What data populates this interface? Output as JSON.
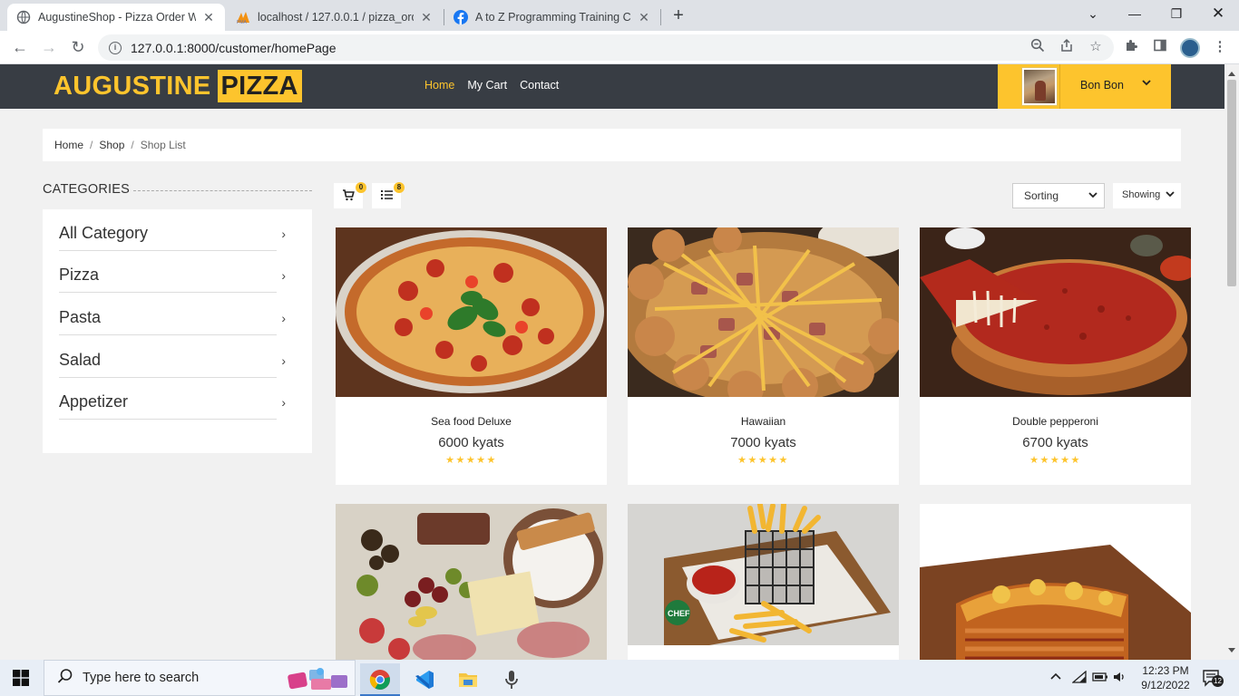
{
  "browser": {
    "tabs": [
      {
        "title": "AugustineShop - Pizza Order We",
        "active": true,
        "icon": "globe-icon"
      },
      {
        "title": "localhost / 127.0.0.1 / pizza_orde",
        "active": false,
        "icon": "phpmyadmin-icon"
      },
      {
        "title": "A to Z Programming Training Co",
        "active": false,
        "icon": "facebook-icon"
      }
    ],
    "url": "127.0.0.1:8000/customer/homePage"
  },
  "site": {
    "logo_part1": "AUGUSTINE",
    "logo_part2": "PIZZA",
    "nav": [
      {
        "label": "Home",
        "active": true
      },
      {
        "label": "My Cart",
        "active": false
      },
      {
        "label": "Contact",
        "active": false
      }
    ],
    "user": {
      "name": "Bon Bon"
    },
    "accent": "#fdc42d",
    "header_bg": "#383d44"
  },
  "breadcrumb": {
    "items": [
      "Home",
      "Shop",
      "Shop List"
    ]
  },
  "categories": {
    "title": "CATEGORIES",
    "items": [
      "All Category",
      "Pizza",
      "Pasta",
      "Salad",
      "Appetizer"
    ]
  },
  "toolbar": {
    "cart_count": "0",
    "list_count": "8",
    "sorting_label": "Sorting",
    "showing_label": "Showing"
  },
  "products": [
    {
      "name": "Sea food Deluxe",
      "price": "6000 kyats",
      "rating": 5,
      "image": "pizza-margherita"
    },
    {
      "name": "Hawaiian",
      "price": "7000 kyats",
      "rating": 5,
      "image": "pizza-hawaiian"
    },
    {
      "name": "Double pepperoni",
      "price": "6700 kyats",
      "rating": 5,
      "image": "pizza-deep-dish"
    },
    {
      "name": "",
      "price": "",
      "rating": 0,
      "image": "appetizer-platter"
    },
    {
      "name": "",
      "price": "",
      "rating": 0,
      "image": "french-fries"
    },
    {
      "name": "",
      "price": "",
      "rating": 0,
      "image": "lasagna"
    }
  ],
  "taskbar": {
    "search_placeholder": "Type here to search",
    "time": "12:23 PM",
    "date": "9/12/2022",
    "notifications": "12"
  }
}
